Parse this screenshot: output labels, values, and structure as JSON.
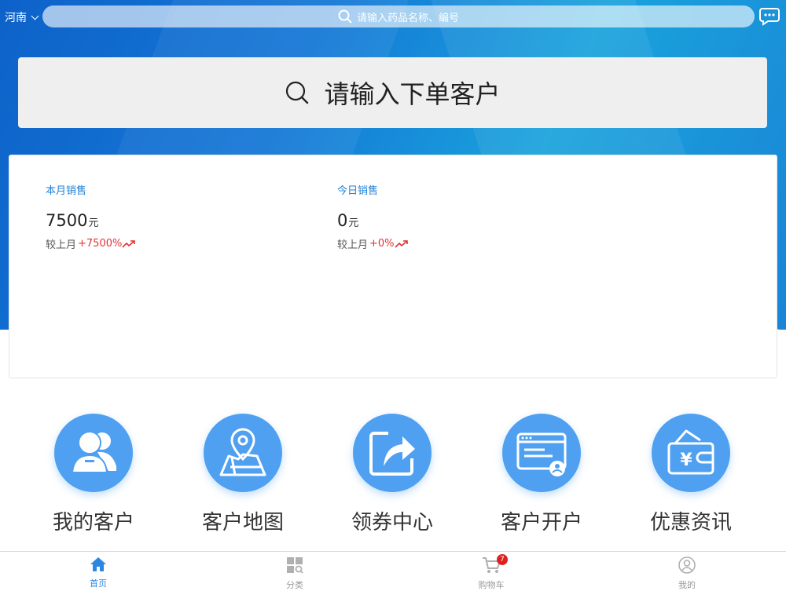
{
  "header": {
    "region": "河南",
    "search_placeholder": "请输入药品名称、编号"
  },
  "customer_search": {
    "placeholder": "请输入下单客户"
  },
  "stats": [
    {
      "label": "本月销售",
      "value": "7500",
      "unit": "元",
      "compare_label": "较上月",
      "change": "+7500%"
    },
    {
      "label": "今日销售",
      "value": "0",
      "unit": "元",
      "compare_label": "较上月",
      "change": "+0%"
    }
  ],
  "quick_actions": [
    {
      "label": "我的客户",
      "icon": "customers-icon"
    },
    {
      "label": "客户地图",
      "icon": "map-pin-icon"
    },
    {
      "label": "领券中心",
      "icon": "share-arrow-icon"
    },
    {
      "label": "客户开户",
      "icon": "account-card-icon"
    },
    {
      "label": "优惠资讯",
      "icon": "wallet-yen-icon"
    }
  ],
  "tabbar": {
    "items": [
      {
        "label": "首页",
        "icon": "home-icon",
        "active": true
      },
      {
        "label": "分类",
        "icon": "category-icon",
        "active": false
      },
      {
        "label": "购物车",
        "icon": "cart-icon",
        "active": false,
        "badge": "7"
      },
      {
        "label": "我的",
        "icon": "user-icon",
        "active": false
      }
    ]
  },
  "colors": {
    "accent": "#2a88e0",
    "icon_circle": "#4fa0f0",
    "positive_change": "#e53232"
  }
}
